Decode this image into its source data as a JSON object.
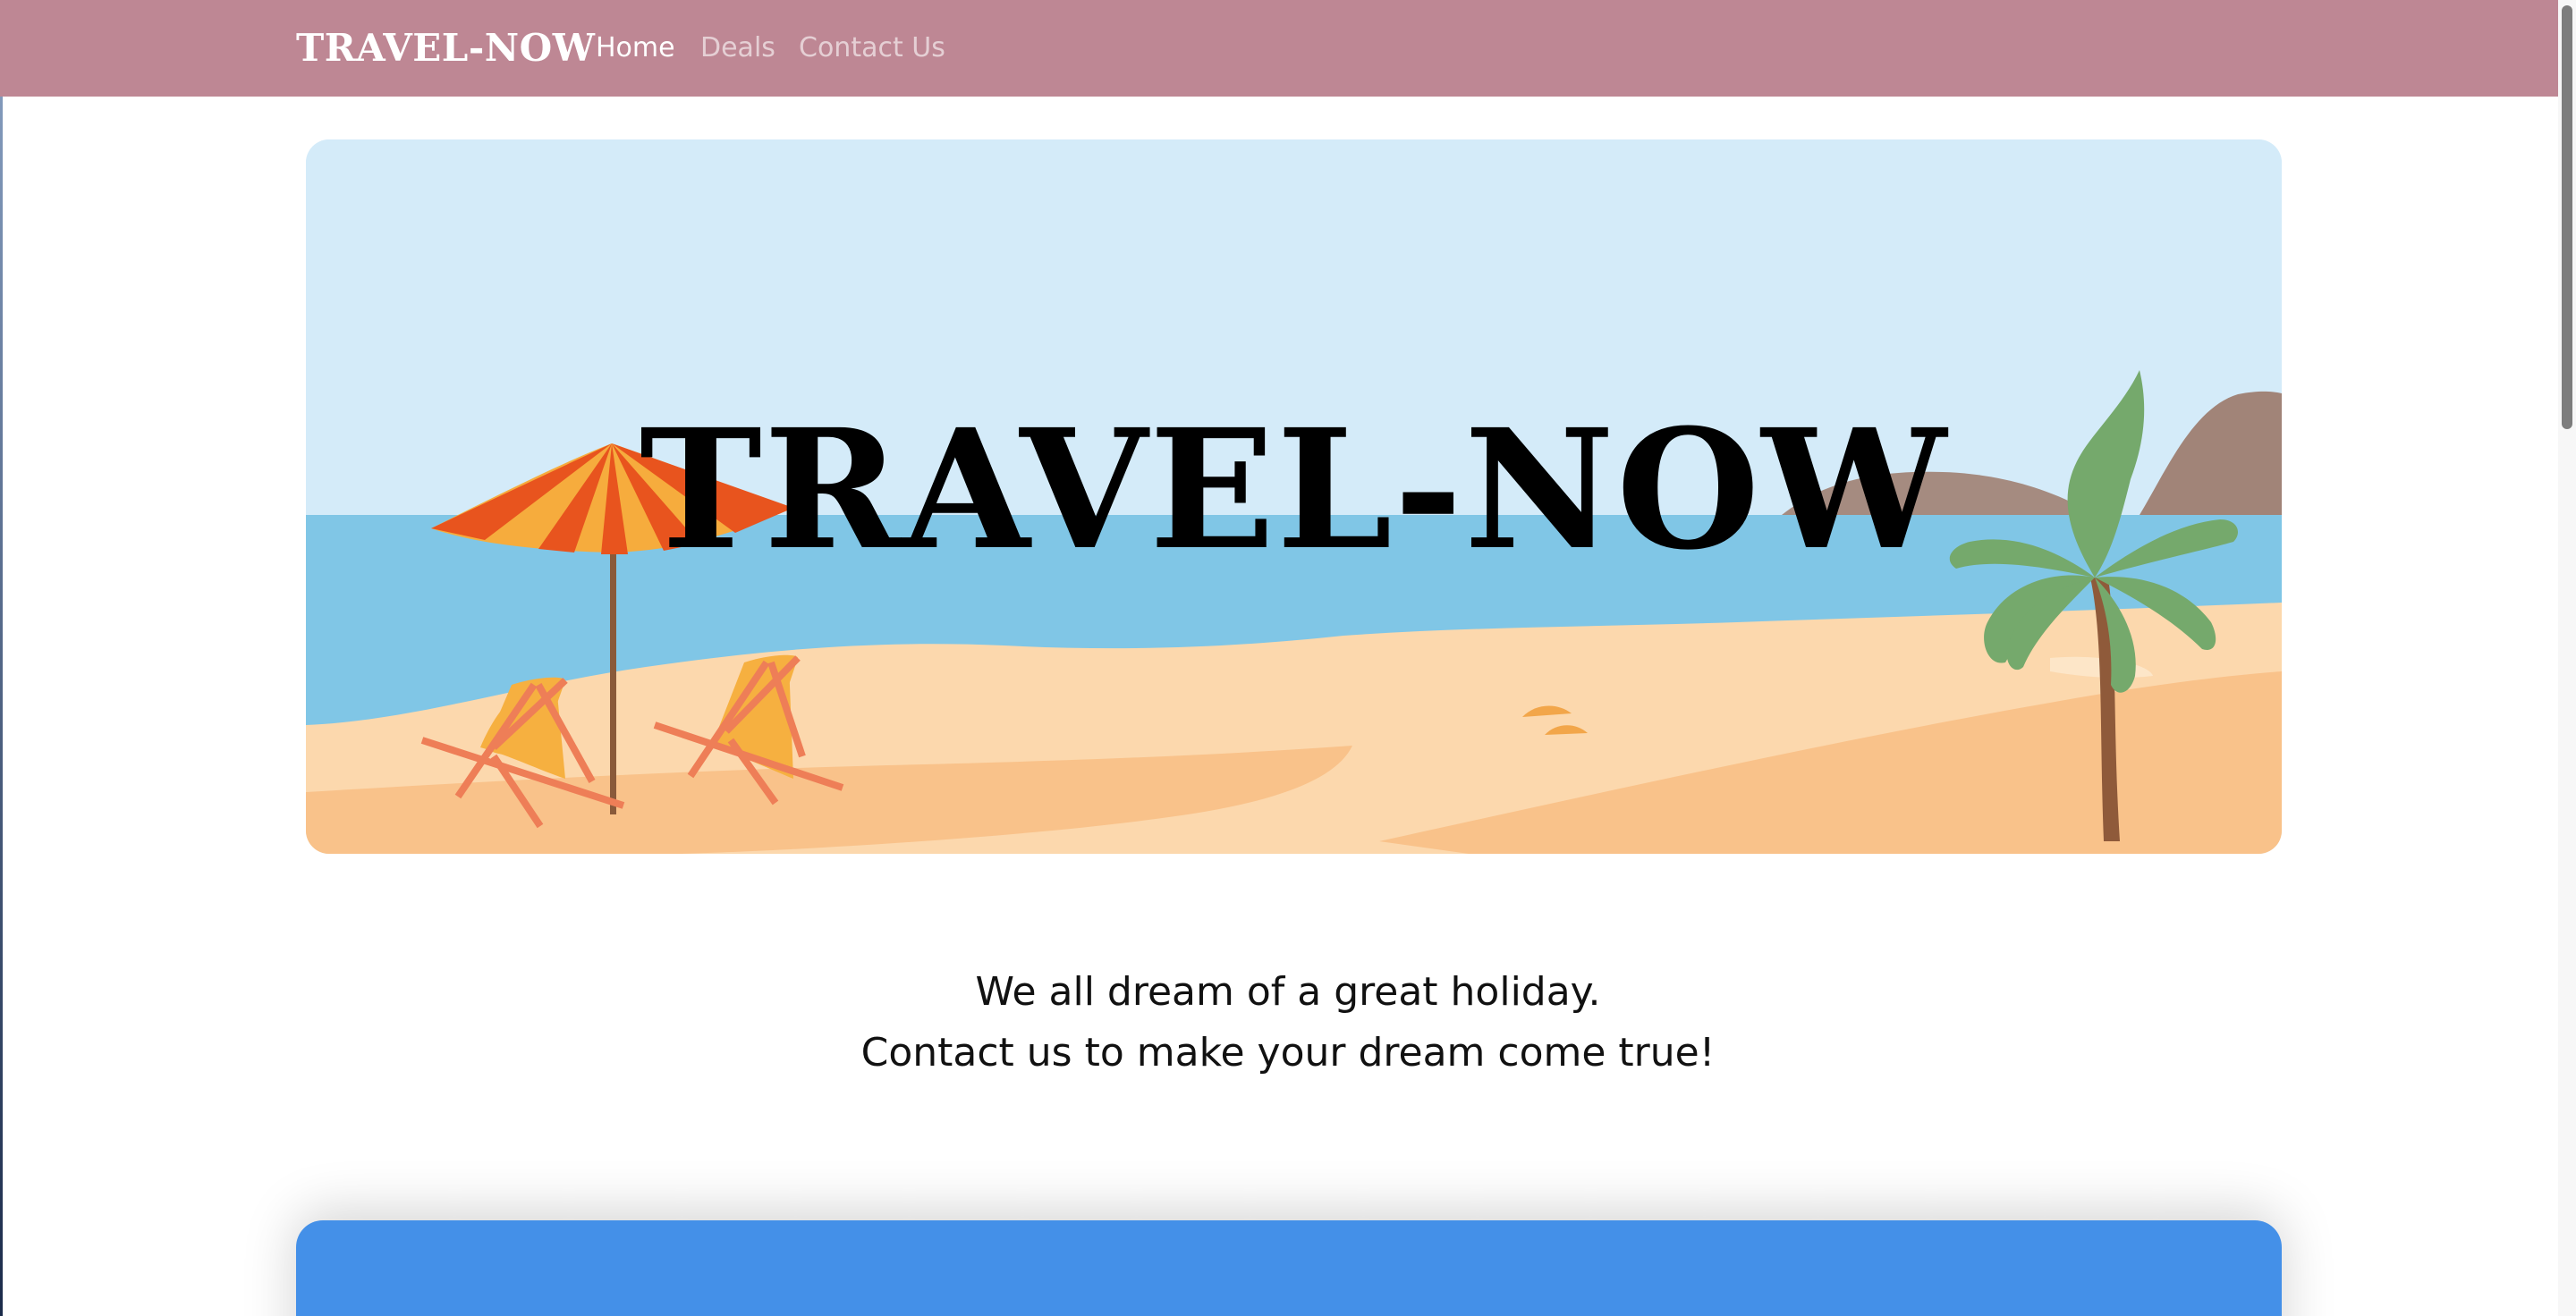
{
  "navbar": {
    "brand": "TRAVEL-NOW",
    "links": [
      {
        "label": "Home",
        "active": true
      },
      {
        "label": "Deals",
        "active": false
      },
      {
        "label": "Contact Us",
        "active": false
      }
    ],
    "background": "#be8794"
  },
  "hero": {
    "title": "TRAVEL-NOW",
    "illustration_icon": "beach-scene-illustration"
  },
  "tagline": {
    "line1": "We all dream of a great holiday.",
    "line2": "Contact us to make your dream come true!"
  },
  "colors": {
    "card_blue": "#4490e8",
    "sky": "#d4ebf9",
    "sea": "#80c6e6",
    "sand": "#fcd8ad"
  }
}
